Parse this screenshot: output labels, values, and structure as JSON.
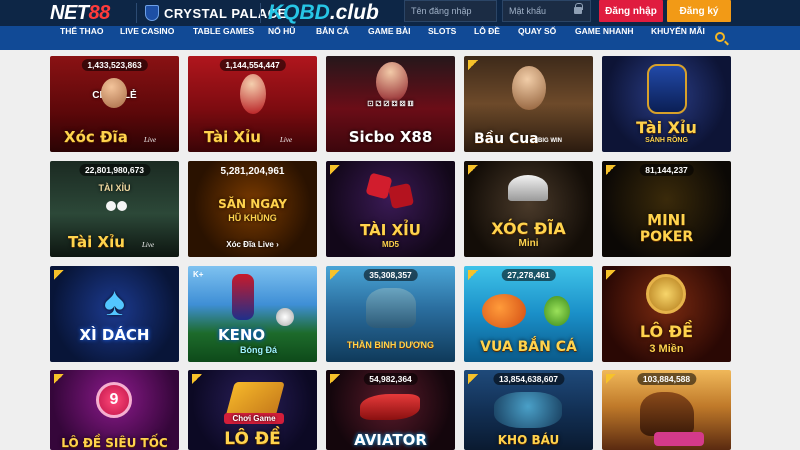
{
  "header": {
    "logo_main": "NET",
    "logo_accent": "88",
    "partner_club": "CRYSTAL PALACE",
    "partner_site": "KQBD",
    "partner_site_tld": ".club",
    "username_placeholder": "Tên đăng nhập",
    "password_placeholder": "Mật khẩu",
    "login_label": "Đăng nhập",
    "register_label": "Đăng ký"
  },
  "nav": {
    "items": [
      "THỂ THAO",
      "LIVE CASINO",
      "TABLE GAMES",
      "NỔ HŨ",
      "BẮN CÁ",
      "GAME BÀI",
      "SLOTS",
      "LÔ ĐỀ",
      "QUAY SỐ",
      "GAME NHANH",
      "KHUYẾN MÃI"
    ]
  },
  "games": [
    {
      "jackpot": "1,433,523,863",
      "title": "Xóc Đĩa",
      "tag": "Live",
      "extra": "CHẴN   LẺ"
    },
    {
      "jackpot": "1,144,554,447",
      "title": "Tài Xỉu",
      "tag": "Live"
    },
    {
      "jackpot": "",
      "title": "Sicbo X88",
      "tag": ""
    },
    {
      "jackpot": "",
      "title": "Bầu Cua",
      "tag": "BIG WIN"
    },
    {
      "jackpot": "",
      "title": "Tài Xỉu",
      "sub": "SẢNH RỒNG"
    },
    {
      "jackpot": "22,801,980,673",
      "title": "Tài Xỉu",
      "tag": "Live",
      "extra": "TÀI    XỈU"
    },
    {
      "jackpot": "5,281,204,961",
      "title": "SĂN NGAY",
      "sub": "HŨ KHỦNG",
      "sub2": "Xóc Đĩa Live ›"
    },
    {
      "jackpot": "",
      "title": "TÀI XỈU",
      "sub": "MD5"
    },
    {
      "jackpot": "",
      "title": "XÓC ĐĨA",
      "sub": "Mini"
    },
    {
      "jackpot": "81,144,237",
      "title": "MINI",
      "sub": "POKER"
    },
    {
      "jackpot": "",
      "title": "XÌ DÁCH"
    },
    {
      "jackpot": "",
      "title": "KENO",
      "sub": "Bóng Đá",
      "badge": "K+"
    },
    {
      "jackpot": "35,308,357",
      "title": "",
      "sub": "THẦN BINH DƯƠNG"
    },
    {
      "jackpot": "27,278,461",
      "title": "VUA BẮN CÁ"
    },
    {
      "jackpot": "",
      "title": "LÔ ĐỀ",
      "sub": "3 Miền"
    },
    {
      "jackpot": "",
      "title": "LÔ ĐỀ SIÊU TỐC",
      "ball": "9"
    },
    {
      "jackpot": "",
      "title": "LÔ ĐỀ",
      "sub": "Chơi Game"
    },
    {
      "jackpot": "54,982,364",
      "title": "AVIATOR"
    },
    {
      "jackpot": "13,854,638,607",
      "title": "KHO BÁU"
    },
    {
      "jackpot": "103,884,588",
      "title": ""
    }
  ],
  "colors": {
    "header_bg": "#0d2646",
    "nav_bg": "#114a96",
    "login": "#e01c3f",
    "register": "#f29a16",
    "page_bg": "#efefef"
  }
}
